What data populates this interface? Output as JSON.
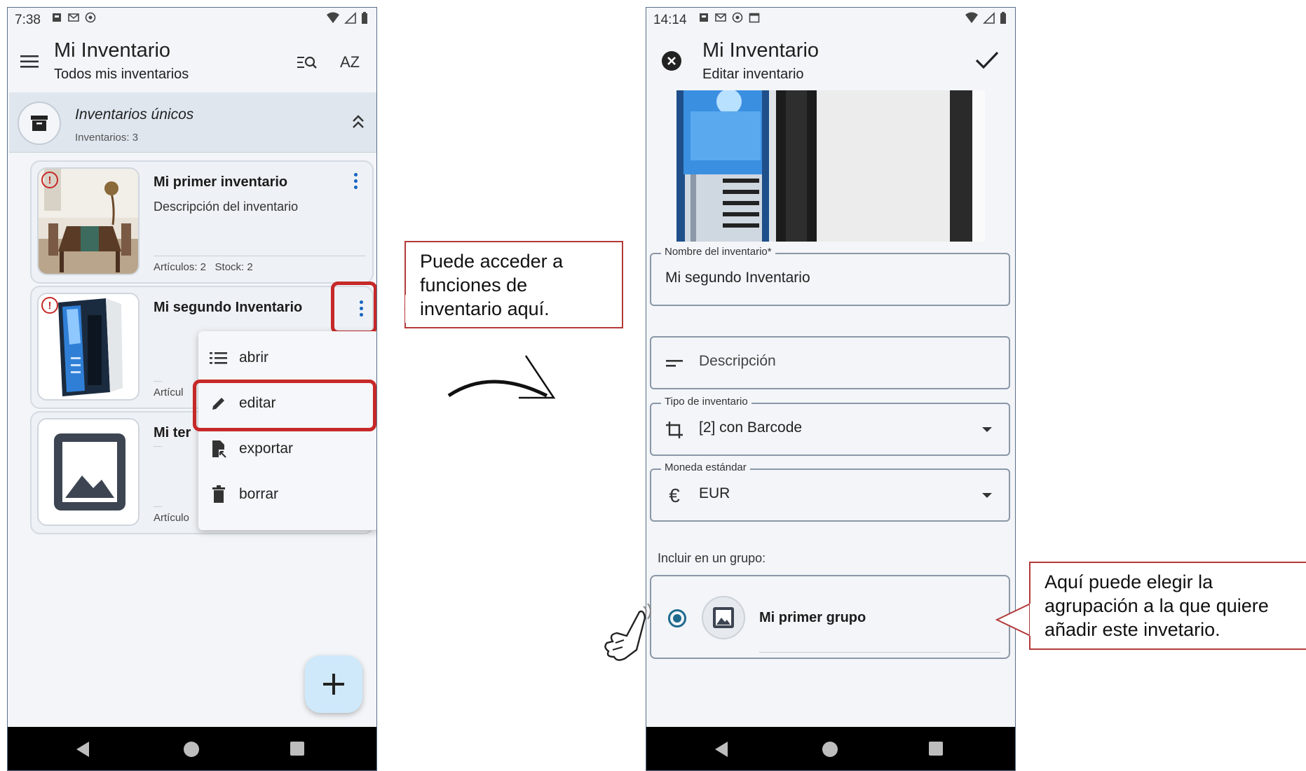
{
  "screen1": {
    "status": {
      "time": "7:38"
    },
    "appbar": {
      "title": "Mi Inventario",
      "subtitle": "Todos mis inventarios",
      "menu_icon": "menu-icon",
      "search_icon": "search-list-icon",
      "sort_icon": "sort-az-icon",
      "sort_label": "AZ"
    },
    "group": {
      "title": "Inventarios únicos",
      "count": "Inventarios: 3"
    },
    "cards": [
      {
        "title": "Mi primer inventario",
        "description": "Descripción del inventario",
        "meta": "Artículos: 2   Stock: 2"
      },
      {
        "title": "Mi segundo Inventario",
        "meta": "Artícul"
      },
      {
        "title": "Mi ter",
        "meta": "Artículo"
      }
    ],
    "warning_symbol": "!",
    "menu": [
      {
        "label": "abrir",
        "icon": "list-icon"
      },
      {
        "label": "editar",
        "icon": "pencil-icon"
      },
      {
        "label": "exportar",
        "icon": "file-export-icon"
      },
      {
        "label": "borrar",
        "icon": "trash-icon"
      }
    ],
    "fab_icon": "plus-icon"
  },
  "callout1": "Puede acceder a funciones de inventario aquí.",
  "screen2": {
    "status": {
      "time": "14:14"
    },
    "appbar": {
      "title": "Mi Inventario",
      "subtitle": "Editar inventario",
      "close_icon": "close-circle-icon",
      "confirm_icon": "check-icon"
    },
    "fields": {
      "name": {
        "label": "Nombre del inventario*",
        "value": "Mi segundo Inventario"
      },
      "description": {
        "placeholder": "Descripción"
      },
      "type": {
        "label": "Tipo de inventario",
        "value": "[2] con Barcode"
      },
      "currency": {
        "label": "Moneda estándar",
        "value": "EUR",
        "symbol": "€"
      }
    },
    "include_label": "Incluir en un grupo:",
    "group_option": {
      "name": "Mi primer grupo",
      "selected": true
    }
  },
  "callout2": "Aquí puede elegir la agrupación a la que quiere añadir este invetario.",
  "colors": {
    "highlight": "#c62828",
    "fab": "#cfe9fb",
    "radio": "#1e6a8e",
    "kebab": "#1565c0"
  }
}
